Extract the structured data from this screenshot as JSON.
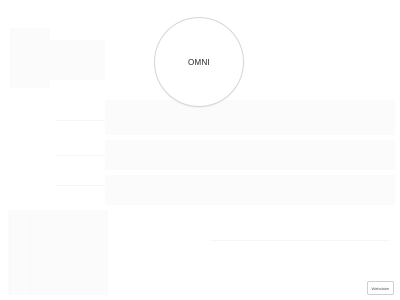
{
  "logo": {
    "text": "OMNI"
  },
  "corner_button": {
    "label": "Webclaim"
  },
  "colors": {
    "background": "#ffffff",
    "circle_border": "#d6d6d6",
    "logo_text": "#222222"
  }
}
